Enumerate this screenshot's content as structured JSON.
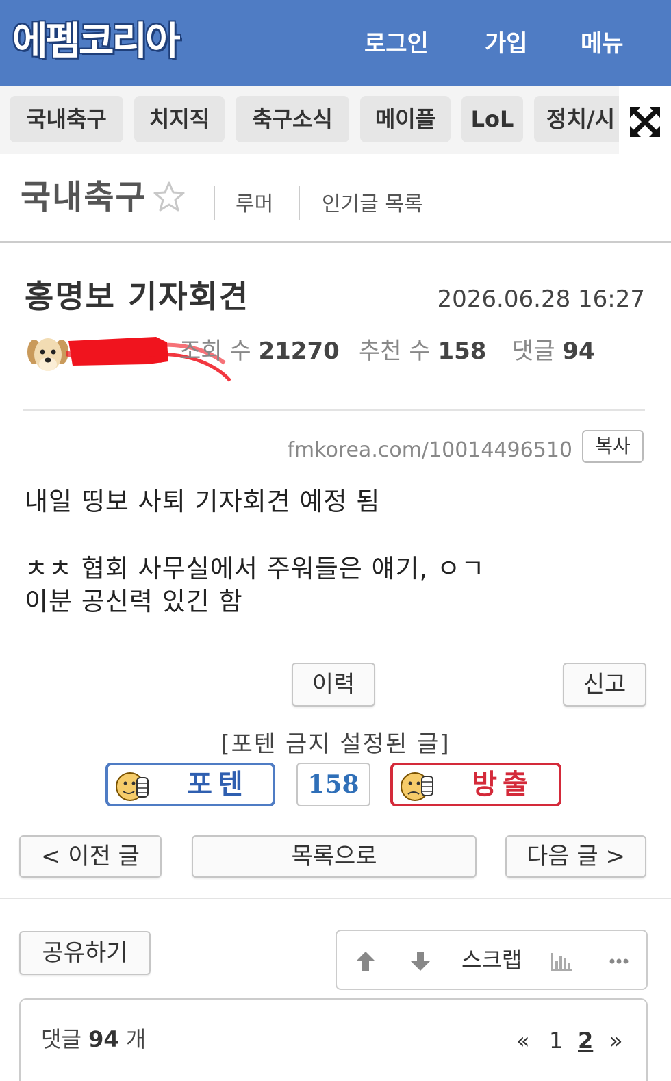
{
  "header": {
    "logo_text": "에펨코리아",
    "nav": [
      "로그인",
      "가입",
      "메뉴"
    ],
    "brand_color": "#4f7cc4"
  },
  "categories": [
    "국내축구",
    "치지직",
    "축구소식",
    "메이플",
    "LoL",
    "정치/시"
  ],
  "board": {
    "title": "국내축구",
    "links": [
      "루머",
      "인기글 목록"
    ]
  },
  "post": {
    "title": "홍명보 기자회견",
    "date": "2026.06.28 16:27",
    "views_label": "조회 수",
    "views": "21270",
    "recommend_label": "추천 수",
    "recommend": "158",
    "comments_label": "댓글",
    "comments": "94",
    "short_url": "fmkorea.com/10014496510",
    "copy_label": "복사",
    "body": [
      "내일 띵보 사퇴 기자회견 예정 됨",
      "ㅊㅊ 협회 사무실에서 주워들은 얘기, ㅇㄱ",
      "이분 공신력 있긴 함"
    ]
  },
  "actions": {
    "history": "이력",
    "report": "신고",
    "notice": "[포텐 금지 설정된 글]",
    "vote_up": "포텐",
    "vote_count": "158",
    "vote_down": "방출"
  },
  "navigation": {
    "prev": "< 이전 글",
    "list": "목록으로",
    "next": "다음 글 >"
  },
  "tools": {
    "share": "공유하기",
    "scrap": "스크랩"
  },
  "comments_section": {
    "label": "댓글",
    "count": "94",
    "unit": "개",
    "pager": {
      "prev": "«",
      "pages": [
        "1",
        "2"
      ],
      "current": "2",
      "next": "»"
    }
  }
}
